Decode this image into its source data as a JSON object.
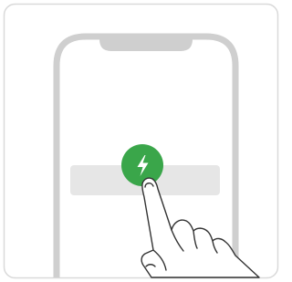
{
  "card": {
    "border_color": "#d9d9d9",
    "background": "#ffffff"
  },
  "phone": {
    "frame_color": "#cfcfcf",
    "screen_color": "#ffffff"
  },
  "action_bar": {
    "color": "#e6e6e6"
  },
  "action_button": {
    "icon": "lightning-bolt-icon",
    "color": "#3aa64a",
    "icon_color": "#ffffff"
  },
  "hand": {
    "icon": "tapping-hand-icon",
    "stroke_color": "#333333"
  }
}
